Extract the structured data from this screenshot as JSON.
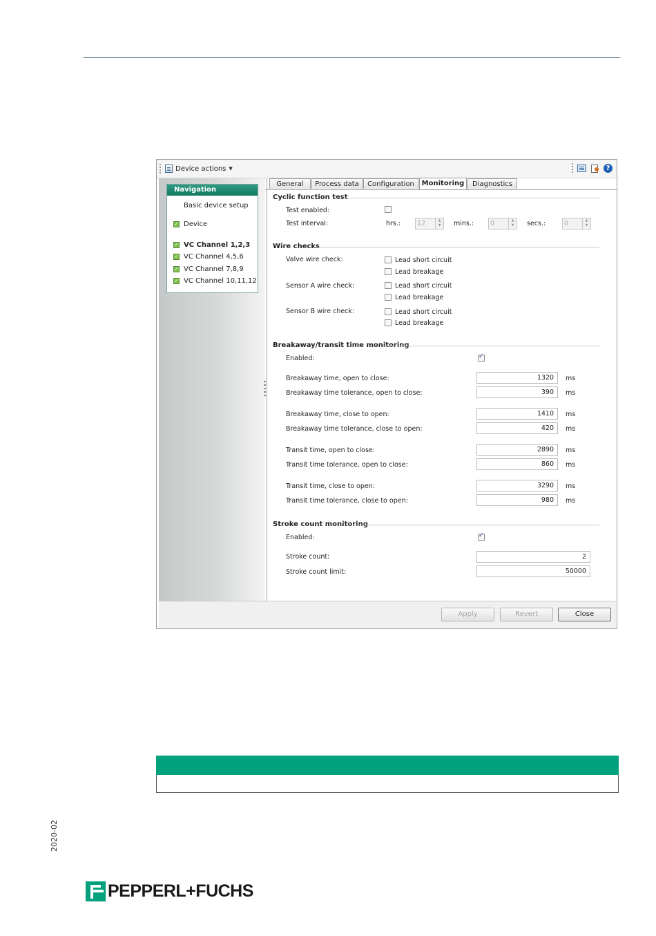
{
  "toolbar": {
    "device_actions": "Device actions"
  },
  "navigation": {
    "title": "Navigation",
    "items": [
      {
        "label": "Basic device setup",
        "checked": false
      },
      {
        "label": "Device",
        "checked": true
      },
      {
        "label": "VC Channel 1,2,3",
        "checked": true,
        "selected": true
      },
      {
        "label": "VC Channel 4,5,6",
        "checked": true
      },
      {
        "label": "VC Channel 7,8,9",
        "checked": true
      },
      {
        "label": "VC Channel 10,11,12",
        "checked": true
      }
    ]
  },
  "tabs": [
    "General",
    "Process data",
    "Configuration",
    "Monitoring",
    "Diagnostics"
  ],
  "active_tab": "Monitoring",
  "cyclic": {
    "title": "Cyclic function test",
    "test_enabled_label": "Test enabled:",
    "test_enabled": false,
    "interval_label": "Test interval:",
    "hrs_label": "hrs.:",
    "hrs": "12",
    "mins_label": "mins.:",
    "mins": "0",
    "secs_label": "secs.:",
    "secs": "0"
  },
  "wire": {
    "title": "Wire checks",
    "groups": [
      {
        "label": "Valve wire check:",
        "short": "Lead short circuit",
        "breakage": "Lead breakage"
      },
      {
        "label": "Sensor A wire check:",
        "short": "Lead short circuit",
        "breakage": "Lead breakage"
      },
      {
        "label": "Sensor B wire check:",
        "short": "Lead short circuit",
        "breakage": "Lead breakage"
      }
    ]
  },
  "breakaway": {
    "title": "Breakaway/transit time monitoring",
    "enabled_label": "Enabled:",
    "enabled": true,
    "unit": "ms",
    "rows": [
      {
        "label": "Breakaway time, open to close:",
        "value": "1320"
      },
      {
        "label": "Breakaway time tolerance, open to close:",
        "value": "390"
      },
      {
        "label": "Breakaway time, close to open:",
        "value": "1410"
      },
      {
        "label": "Breakaway time tolerance, close to open:",
        "value": "420"
      },
      {
        "label": "Transit time, open to close:",
        "value": "2890"
      },
      {
        "label": "Transit time tolerance, open to close:",
        "value": "860"
      },
      {
        "label": "Transit time, close to open:",
        "value": "3290"
      },
      {
        "label": "Transit time tolerance, close to open:",
        "value": "980"
      }
    ]
  },
  "stroke": {
    "title": "Stroke count monitoring",
    "enabled_label": "Enabled:",
    "enabled": true,
    "count_label": "Stroke count:",
    "count": "2",
    "limit_label": "Stroke count limit:",
    "limit": "50000"
  },
  "buttons": {
    "apply": "Apply",
    "revert": "Revert",
    "close": "Close"
  },
  "footer": {
    "date": "2020-02",
    "brand": "PEPPERL+FUCHS"
  },
  "colors": {
    "brand_green": "#00a17c",
    "nav_header": "#117a62"
  }
}
